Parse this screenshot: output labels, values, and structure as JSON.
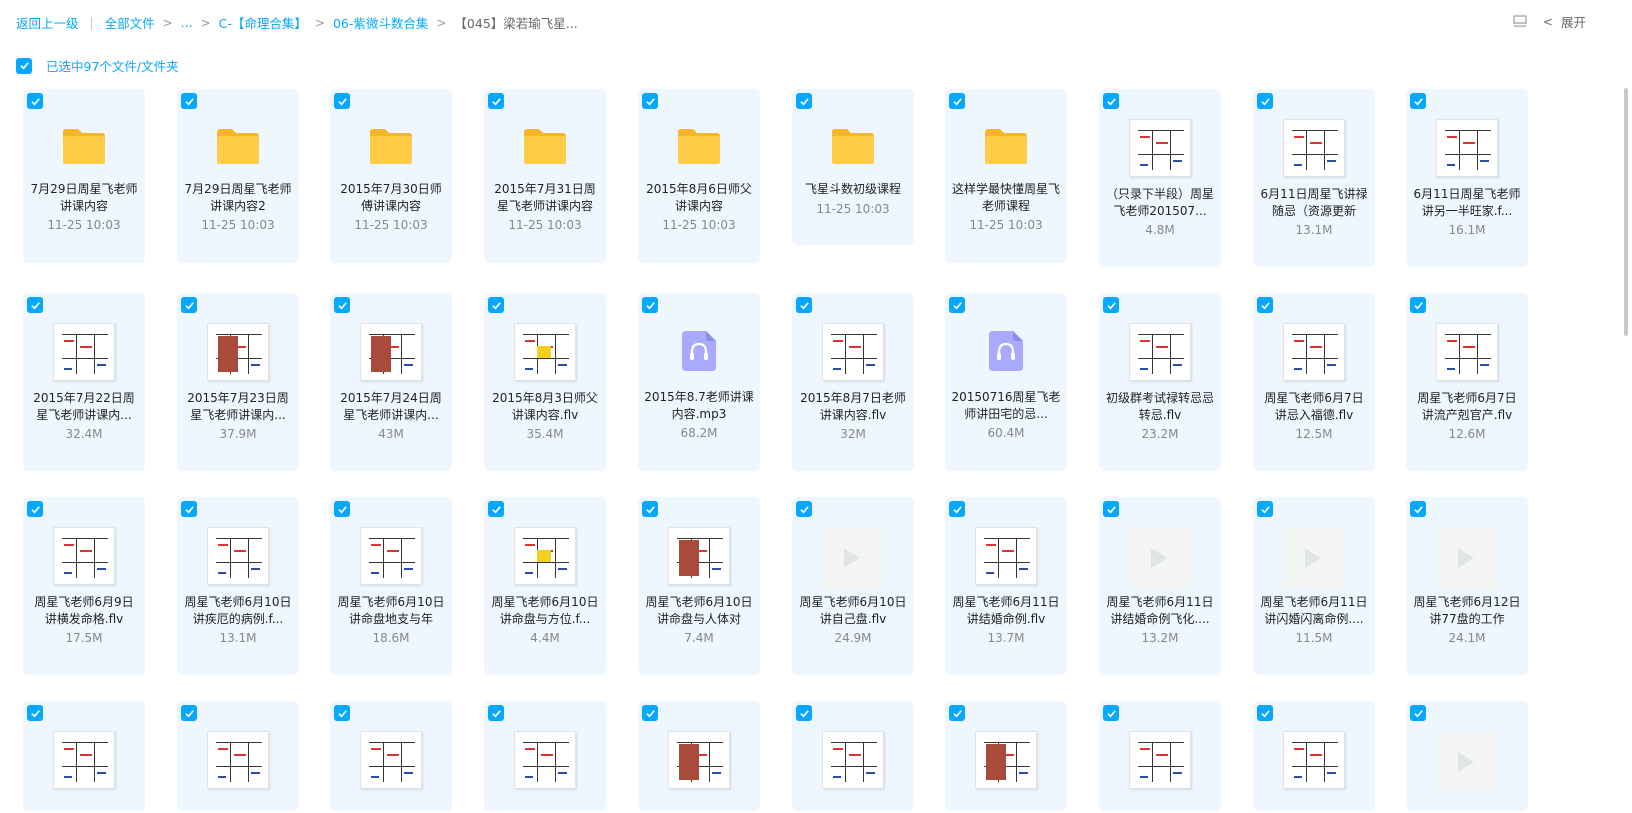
{
  "breadcrumb": {
    "back": "返回上一级",
    "all_files": "全部文件",
    "ellipsis": "...",
    "level1": "C-【命理合集】",
    "level2": "06-紫微斗数合集",
    "current": "【045】梁若瑜飞星..."
  },
  "top_right": {
    "expand": "展开"
  },
  "selection": {
    "label": "已选中97个文件/文件夹"
  },
  "colors": {
    "accent": "#06a7ff",
    "card_bg": "#eef7ff",
    "folder": "#ffc93f",
    "audio": "#a5a6ff"
  },
  "rows": [
    [
      {
        "type": "folder",
        "name": "7月29日周星飞老师讲课内容",
        "meta": "11-25 10:03"
      },
      {
        "type": "folder",
        "name": "7月29日周星飞老师讲课内容2",
        "meta": "11-25 10:03"
      },
      {
        "type": "folder",
        "name": "2015年7月30日师傅讲课内容",
        "meta": "11-25 10:03"
      },
      {
        "type": "folder",
        "name": "2015年7月31日周星飞老师讲课内容",
        "meta": "11-25 10:03"
      },
      {
        "type": "folder",
        "name": "2015年8月6日师父讲课内容",
        "meta": "11-25 10:03"
      },
      {
        "type": "folder",
        "name": "飞星斗数初级课程",
        "meta": "11-25 10:03"
      },
      {
        "type": "folder",
        "name": "这样学最快懂周星飞老师课程",
        "meta": "11-25 10:03"
      },
      {
        "type": "doc",
        "name": "（只录下半段）周星飞老师201507...",
        "meta": "4.8M"
      },
      {
        "type": "doc",
        "name": "6月11日周星飞讲禄随忌（资源更新",
        "meta": "13.1M"
      },
      {
        "type": "doc",
        "name": "6月11日周星飞老师讲另一半旺家.f...",
        "meta": "16.1M"
      }
    ],
    [
      {
        "type": "doc",
        "name": "2015年7月22日周星飞老师讲课内...",
        "meta": "32.4M"
      },
      {
        "type": "docpic",
        "name": "2015年7月23日周星飞老师讲课内...",
        "meta": "37.9M"
      },
      {
        "type": "docpic",
        "name": "2015年7月24日周星飞老师讲课内...",
        "meta": "43M"
      },
      {
        "type": "docyl",
        "name": "2015年8月3日师父讲课内容.flv",
        "meta": "35.4M"
      },
      {
        "type": "audio",
        "name": "2015年8.7老师讲课内容.mp3",
        "meta": "68.2M"
      },
      {
        "type": "doc",
        "name": "2015年8月7日老师讲课内容.flv",
        "meta": "32M"
      },
      {
        "type": "audio",
        "name": "20150716周星飞老师讲田宅的忌...",
        "meta": "60.4M"
      },
      {
        "type": "doc",
        "name": "初级群考试禄转忌忌转忌.flv",
        "meta": "23.2M"
      },
      {
        "type": "doc",
        "name": "周星飞老师6月7日讲忌入福德.flv",
        "meta": "12.5M"
      },
      {
        "type": "doc",
        "name": "周星飞老师6月7日讲流产剋官产.flv",
        "meta": "12.6M"
      }
    ],
    [
      {
        "type": "doc",
        "name": "周星飞老师6月9日讲横发命格.flv",
        "meta": "17.5M"
      },
      {
        "type": "doc",
        "name": "周星飞老师6月10日讲疾厄的病例.f...",
        "meta": "13.1M"
      },
      {
        "type": "doc",
        "name": "周星飞老师6月10日讲命盘地支与年",
        "meta": "18.6M"
      },
      {
        "type": "docyl",
        "name": "周星飞老师6月10日讲命盘与方位.f...",
        "meta": "4.4M"
      },
      {
        "type": "docpic",
        "name": "周星飞老师6月10日讲命盘与人体对",
        "meta": "7.4M"
      },
      {
        "type": "video",
        "name": "周星飞老师6月10日讲自己盘.flv",
        "meta": "24.9M"
      },
      {
        "type": "doc",
        "name": "周星飞老师6月11日讲结婚命例.flv",
        "meta": "13.7M"
      },
      {
        "type": "video",
        "name": "周星飞老师6月11日讲结婚命例飞化....",
        "meta": "13.2M"
      },
      {
        "type": "video",
        "name": "周星飞老师6月11日讲闪婚闪离命例....",
        "meta": "11.5M"
      },
      {
        "type": "video",
        "name": "周星飞老师6月12日讲77盘的工作",
        "meta": "24.1M"
      }
    ],
    [
      {
        "type": "doc"
      },
      {
        "type": "doc"
      },
      {
        "type": "doc"
      },
      {
        "type": "doc"
      },
      {
        "type": "docpic"
      },
      {
        "type": "doc"
      },
      {
        "type": "docpic"
      },
      {
        "type": "doc"
      },
      {
        "type": "doc"
      },
      {
        "type": "video"
      }
    ]
  ]
}
